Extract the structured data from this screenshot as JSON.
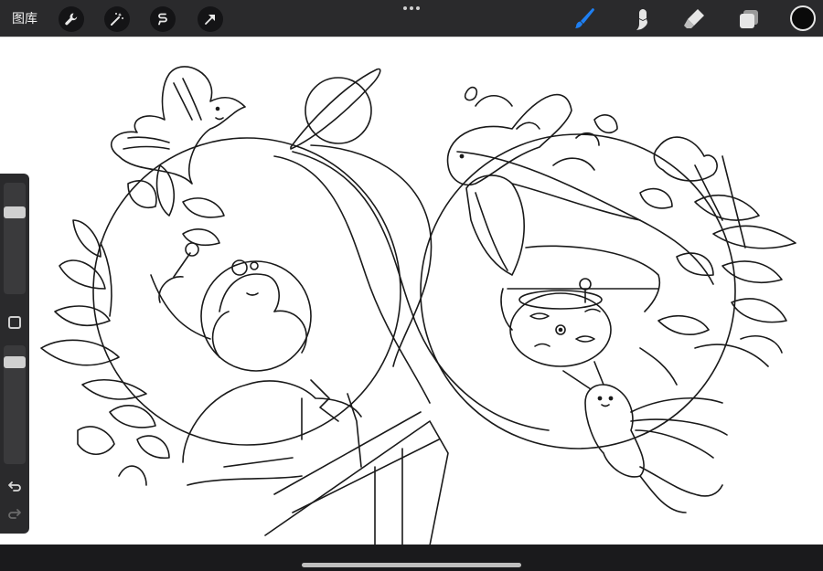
{
  "topbar": {
    "gallery_label": "图库",
    "left_tools": [
      "wrench-icon",
      "magic-wand-icon",
      "selection-icon",
      "transform-arrow-icon"
    ],
    "right_tools": [
      "brush-icon",
      "smudge-icon",
      "eraser-icon",
      "layers-icon"
    ],
    "active_tool": "brush-icon",
    "accent_color": "#1e7ff2",
    "current_color": "#0a0a0a"
  },
  "sidebar": {
    "brush_size_level": 0.24,
    "brush_opacity_level": 0.1,
    "icons": [
      "square-modify-icon",
      "undo-icon",
      "redo-icon"
    ]
  },
  "canvas": {
    "background": "#ffffff",
    "subject": "line-art-illustration"
  }
}
